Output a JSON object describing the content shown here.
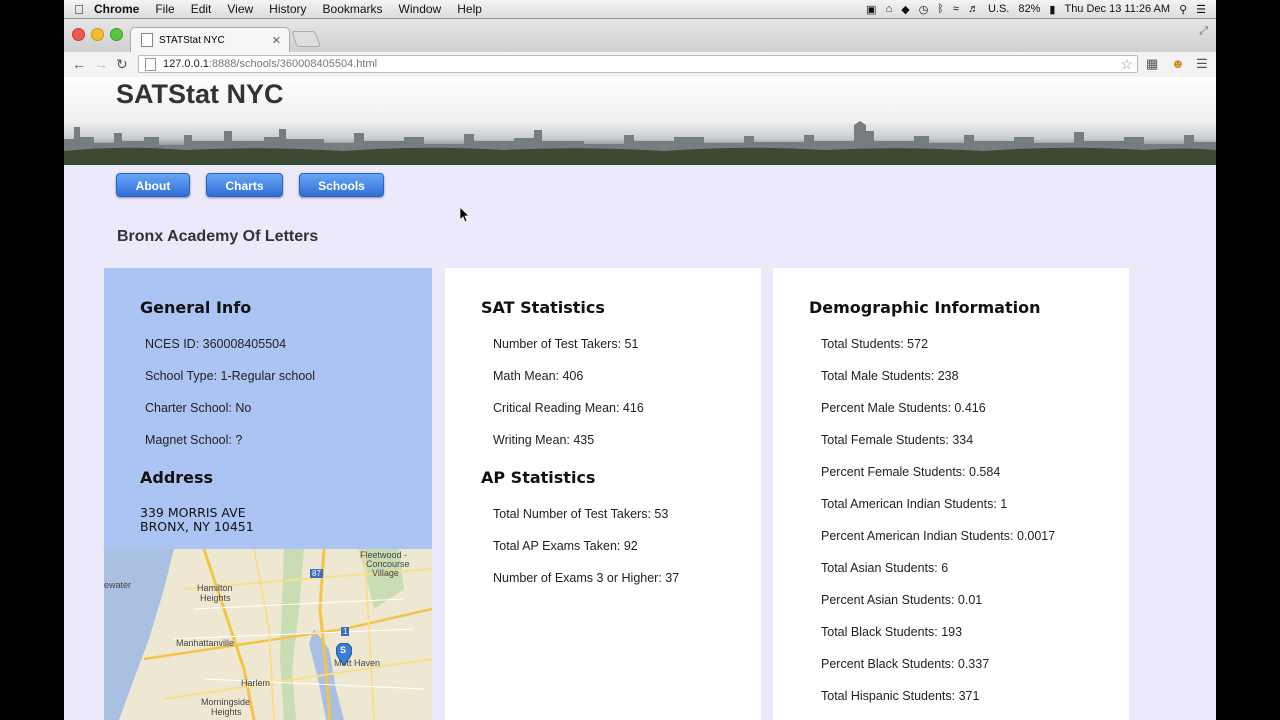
{
  "menubar": {
    "app": "Chrome",
    "items": [
      "File",
      "Edit",
      "View",
      "History",
      "Bookmarks",
      "Window",
      "Help"
    ],
    "input_source": "U.S.",
    "battery": "82%",
    "clock": "Thu Dec 13  11:26 AM"
  },
  "browser": {
    "tab_title": "STATStat NYC",
    "url_host": "127.0.0.1",
    "url_rest": ":8888/schools/360008405504.html"
  },
  "site": {
    "title": "SATStat NYC",
    "nav": [
      "About",
      "Charts",
      "Schools"
    ],
    "school_name": "Bronx Academy Of Letters"
  },
  "general_info": {
    "heading": "General Info",
    "rows": [
      "NCES ID: 360008405504",
      "School Type: 1-Regular school",
      "Charter School: No",
      "Magnet School: ?"
    ],
    "address_heading": "Address",
    "address_line1": "339 MORRIS AVE",
    "address_line2": "BRONX, NY 10451"
  },
  "map": {
    "labels": [
      "Fleetwood -",
      "Concourse",
      "Village",
      "ewater",
      "Hamilton",
      "Heights",
      "Manhattanville",
      "Harlem",
      "Mott Haven",
      "Morningside",
      "Heights"
    ],
    "roads": [
      "87",
      "1"
    ],
    "marker": "S"
  },
  "sat_stats": {
    "heading": "SAT Statistics",
    "rows": [
      "Number of Test Takers: 51",
      "Math Mean: 406",
      "Critical Reading Mean: 416",
      "Writing Mean: 435"
    ]
  },
  "ap_stats": {
    "heading": "AP Statistics",
    "rows": [
      "Total Number of Test Takers: 53",
      "Total AP Exams Taken: 92",
      "Number of Exams 3 or Higher: 37"
    ]
  },
  "demographics": {
    "heading": "Demographic Information",
    "rows": [
      "Total Students: 572",
      "Total Male Students: 238",
      "Percent Male Students: 0.416",
      "Total Female Students: 334",
      "Percent Female Students: 0.584",
      "Total American Indian Students: 1",
      "Percent American Indian Students: 0.0017",
      "Total Asian Students: 6",
      "Percent Asian Students: 0.01",
      "Total Black Students: 193",
      "Percent Black Students: 0.337",
      "Total Hispanic Students: 371"
    ]
  },
  "colors": {
    "page_bg": "#ece9fb",
    "info_panel": "#abc4f3",
    "button": "#2e6fd8"
  }
}
